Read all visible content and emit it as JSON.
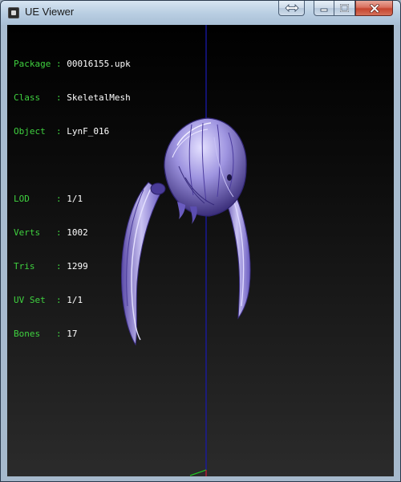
{
  "window": {
    "title": "UE Viewer",
    "accent_color": "#3fd13f",
    "axis_color": "#1a1aa8"
  },
  "titlebar_buttons": {
    "swap": "swap-arrows-icon",
    "minimize": "minimize-icon",
    "maximize": "maximize-icon",
    "close": "close-icon"
  },
  "info": {
    "package": {
      "label": "Package",
      "sep": ":",
      "value": "00016155.upk"
    },
    "class": {
      "label": "Class  ",
      "sep": ":",
      "value": "SkeletalMesh"
    },
    "object": {
      "label": "Object ",
      "sep": ":",
      "value": "LynF_016"
    },
    "lod": {
      "label": "LOD    ",
      "sep": ":",
      "value": "1/1"
    },
    "verts": {
      "label": "Verts  ",
      "sep": ":",
      "value": "1002"
    },
    "tris": {
      "label": "Tris   ",
      "sep": ":",
      "value": "1299"
    },
    "uvset": {
      "label": "UV Set ",
      "sep": ":",
      "value": "1/1"
    },
    "bones": {
      "label": "Bones  ",
      "sep": ":",
      "value": "17"
    }
  },
  "model": {
    "name": "hair-mesh",
    "color": "#8e84d8"
  }
}
